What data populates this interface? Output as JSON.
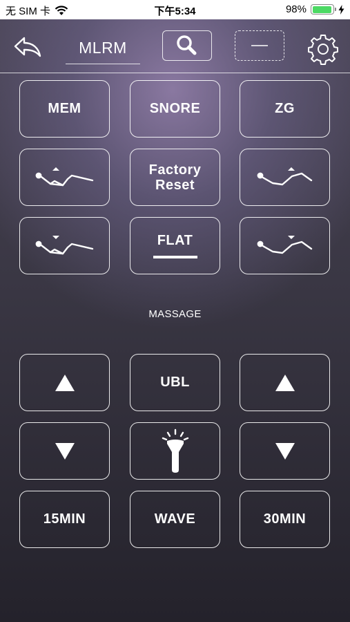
{
  "status_bar": {
    "carrier": "无 SIM 卡",
    "time": "下午5:34",
    "battery_percent": "98%",
    "battery_level": 0.98
  },
  "toolbar": {
    "title": "MLRM",
    "back_icon": "back-arrow-icon",
    "search_icon": "search-icon",
    "scan_icon": "scan-icon",
    "settings_icon": "gear-icon"
  },
  "buttons": {
    "mem": "MEM",
    "snore": "SNORE",
    "zg": "ZG",
    "factory_reset_line1": "Factory",
    "factory_reset_line2": "Reset",
    "flat": "FLAT",
    "ubl": "UBL",
    "wave": "WAVE",
    "min15": "15MIN",
    "min30": "30MIN"
  },
  "section": {
    "massage": "MASSAGE"
  }
}
